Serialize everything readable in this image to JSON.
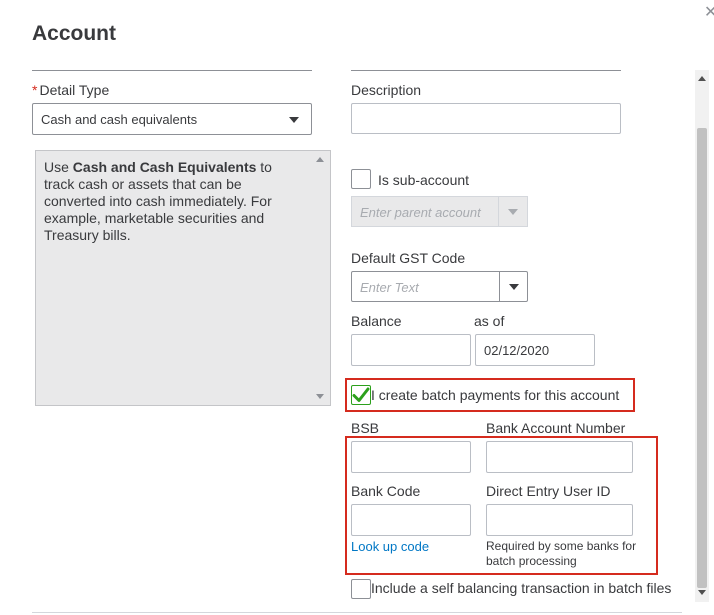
{
  "dialog": {
    "title": "Account"
  },
  "detail_type": {
    "label": "Detail Type",
    "required_marker": "*",
    "value": "Cash and cash equivalents"
  },
  "description": {
    "label": "Description",
    "value": ""
  },
  "info_box": {
    "text_before": "Use ",
    "bold": "Cash and Cash Equivalents",
    "text_after": " to track cash or assets that can be converted into cash immediately. For example, marketable securities and Treasury bills."
  },
  "sub_account": {
    "label": "Is sub-account",
    "checked": false,
    "parent_placeholder": "Enter parent account"
  },
  "gst": {
    "label": "Default GST Code",
    "placeholder": "Enter Text"
  },
  "balance": {
    "label": "Balance",
    "value": "",
    "as_of_label": "as of",
    "as_of_value": "02/12/2020"
  },
  "batch_payments": {
    "label": "I create batch payments for this account",
    "checked": true
  },
  "bsb": {
    "label": "BSB",
    "value": ""
  },
  "bank_account_number": {
    "label": "Bank Account Number",
    "value": ""
  },
  "bank_code": {
    "label": "Bank Code",
    "value": "",
    "link": "Look up code"
  },
  "direct_entry_user_id": {
    "label": "Direct Entry User ID",
    "value": "",
    "helper": "Required by some banks for batch processing"
  },
  "self_balancing": {
    "label": "Include a self balancing transaction in batch files",
    "checked": false
  },
  "colors": {
    "accent_green": "#2ca01c",
    "highlight_red": "#d52b1e",
    "link_blue": "#0077c5"
  }
}
